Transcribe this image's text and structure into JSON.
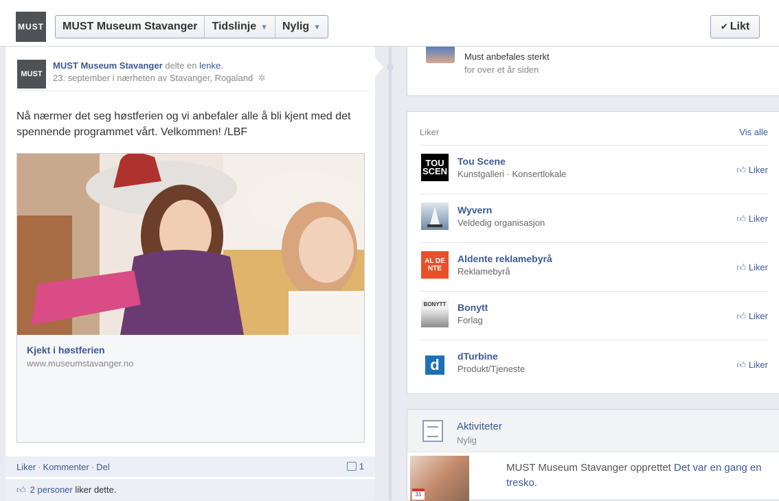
{
  "header": {
    "logo_text": "MUST",
    "page_name_button": "MUST Museum Stavanger",
    "timeline_button": "Tidslinje",
    "recent_button": "Nylig",
    "liked_button": "Likt"
  },
  "post": {
    "avatar_text": "MUST",
    "author": "MUST Museum Stavanger",
    "shared_text": "delte en",
    "shared_link": "lenke.",
    "date": "23. september i nærheten av Stavanger, Rogaland",
    "text": "Nå nærmer det seg høstferien og vi anbefaler alle å bli kjent med det spennende programmet vårt. Velkommen! /LBF",
    "link_title": "Kjekt i høstferien",
    "link_url": "www.museumstavanger.no",
    "actions": [
      "Liker",
      "Kommenter",
      "Del"
    ],
    "comment_count": "1",
    "likes_count": "2 personer",
    "likes_suffix": "liker dette."
  },
  "review": {
    "text": "Must anbefales sterkt",
    "time": "for over et år siden"
  },
  "likes": {
    "header": "Liker",
    "see_all": "Vis alle",
    "like_label": "Liker",
    "items": [
      {
        "name": "Tou Scene",
        "category": "Kunstgalleri · Konsertlokale",
        "icon_text": "TOU SCEN",
        "color": "#000000"
      },
      {
        "name": "Wyvern",
        "category": "Veldedig organisasjon",
        "icon_text": "",
        "color": "#6f8aa8"
      },
      {
        "name": "Aldente reklamebyrå",
        "category": "Reklamebyrå",
        "icon_text": "AL DE NTE",
        "color": "#e8502a"
      },
      {
        "name": "Bonytt",
        "category": "Forlag",
        "icon_text": "BONYTT",
        "color": "#8c8c8c"
      },
      {
        "name": "dTurbine",
        "category": "Produkt/Tjeneste",
        "icon_text": "d",
        "color": "#1f6fb8"
      }
    ]
  },
  "activity": {
    "title": "Aktiviteter",
    "subtitle": "Nylig",
    "calendar_day": "31",
    "text_prefix": "MUST Museum Stavanger opprettet",
    "text_link": "Det var en gang en tresko."
  }
}
